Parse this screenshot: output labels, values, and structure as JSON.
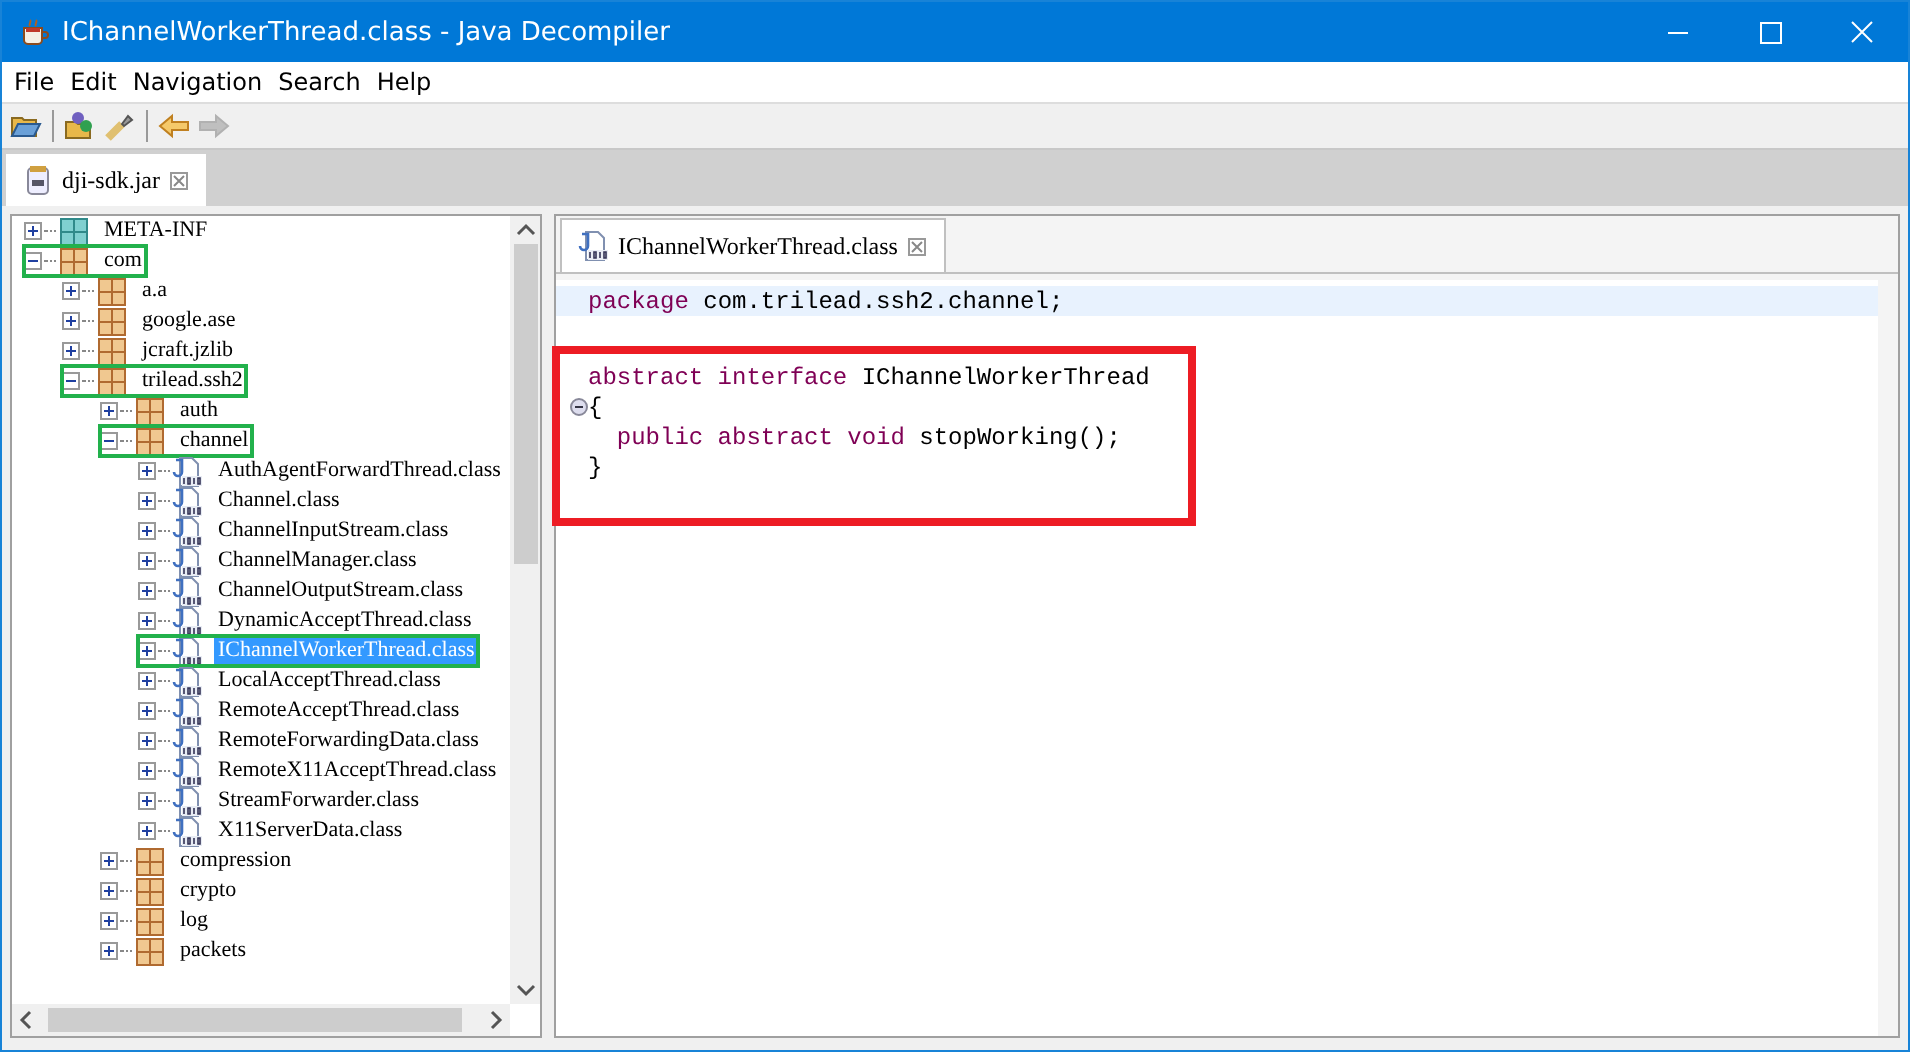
{
  "window": {
    "title": "IChannelWorkerThread.class - Java Decompiler"
  },
  "menu": [
    "File",
    "Edit",
    "Navigation",
    "Search",
    "Help"
  ],
  "toolbar": [
    {
      "kind": "open",
      "disabled": false
    },
    {
      "kind": "sep"
    },
    {
      "kind": "open-type",
      "disabled": false
    },
    {
      "kind": "search",
      "disabled": false
    },
    {
      "kind": "sep"
    },
    {
      "kind": "back",
      "disabled": false
    },
    {
      "kind": "forward",
      "disabled": true
    }
  ],
  "file_tabs": [
    {
      "label": "dji-sdk.jar",
      "selected": true
    }
  ],
  "tree": [
    {
      "label": "META-INF",
      "kind": "folder",
      "expanded": false,
      "selected": false,
      "outlined": false
    },
    {
      "label": "com",
      "kind": "package",
      "expanded": true,
      "selected": false,
      "outlined": true,
      "children": [
        {
          "label": "a.a",
          "kind": "package",
          "expanded": false,
          "selected": false,
          "outlined": false
        },
        {
          "label": "google.ase",
          "kind": "package",
          "expanded": false,
          "selected": false,
          "outlined": false
        },
        {
          "label": "jcraft.jzlib",
          "kind": "package",
          "expanded": false,
          "selected": false,
          "outlined": false
        },
        {
          "label": "trilead.ssh2",
          "kind": "package",
          "expanded": true,
          "selected": false,
          "outlined": true,
          "children": [
            {
              "label": "auth",
              "kind": "package",
              "expanded": false,
              "selected": false,
              "outlined": false
            },
            {
              "label": "channel",
              "kind": "package",
              "expanded": true,
              "selected": false,
              "outlined": true,
              "children": [
                {
                  "label": "AuthAgentForwardThread.class",
                  "kind": "class",
                  "expanded": false,
                  "selected": false,
                  "outlined": false
                },
                {
                  "label": "Channel.class",
                  "kind": "class",
                  "expanded": false,
                  "selected": false,
                  "outlined": false
                },
                {
                  "label": "ChannelInputStream.class",
                  "kind": "class",
                  "expanded": false,
                  "selected": false,
                  "outlined": false
                },
                {
                  "label": "ChannelManager.class",
                  "kind": "class",
                  "expanded": false,
                  "selected": false,
                  "outlined": false
                },
                {
                  "label": "ChannelOutputStream.class",
                  "kind": "class",
                  "expanded": false,
                  "selected": false,
                  "outlined": false
                },
                {
                  "label": "DynamicAcceptThread.class",
                  "kind": "class",
                  "expanded": false,
                  "selected": false,
                  "outlined": false
                },
                {
                  "label": "IChannelWorkerThread.class",
                  "kind": "class",
                  "expanded": false,
                  "selected": true,
                  "outlined": true
                },
                {
                  "label": "LocalAcceptThread.class",
                  "kind": "class",
                  "expanded": false,
                  "selected": false,
                  "outlined": false
                },
                {
                  "label": "RemoteAcceptThread.class",
                  "kind": "class",
                  "expanded": false,
                  "selected": false,
                  "outlined": false
                },
                {
                  "label": "RemoteForwardingData.class",
                  "kind": "class",
                  "expanded": false,
                  "selected": false,
                  "outlined": false
                },
                {
                  "label": "RemoteX11AcceptThread.class",
                  "kind": "class",
                  "expanded": false,
                  "selected": false,
                  "outlined": false
                },
                {
                  "label": "StreamForwarder.class",
                  "kind": "class",
                  "expanded": false,
                  "selected": false,
                  "outlined": false
                },
                {
                  "label": "X11ServerData.class",
                  "kind": "class",
                  "expanded": false,
                  "selected": false,
                  "outlined": false
                }
              ]
            },
            {
              "label": "compression",
              "kind": "package",
              "expanded": false,
              "selected": false,
              "outlined": false
            },
            {
              "label": "crypto",
              "kind": "package",
              "expanded": false,
              "selected": false,
              "outlined": false
            },
            {
              "label": "log",
              "kind": "package",
              "expanded": false,
              "selected": false,
              "outlined": false
            },
            {
              "label": "packets",
              "kind": "package",
              "expanded": false,
              "selected": false,
              "outlined": false
            }
          ]
        }
      ]
    }
  ],
  "editor_tabs": [
    {
      "label": "IChannelWorkerThread.class",
      "selected": true
    }
  ],
  "code": {
    "blocks": [
      {
        "outlined": false,
        "lines": [
          {
            "current": true,
            "foldable": false,
            "tokens": [
              {
                "kind": "keyword",
                "text": "package"
              },
              {
                "kind": "plain",
                "text": " com.trilead.ssh2.channel;"
              }
            ]
          }
        ]
      },
      {
        "outlined": true,
        "lines": [
          {
            "current": false,
            "foldable": false,
            "tokens": [
              {
                "kind": "keyword",
                "text": "abstract"
              },
              {
                "kind": "keyword",
                "text": " interface"
              },
              {
                "kind": "plain",
                "text": " IChannelWorkerThread"
              }
            ]
          },
          {
            "current": false,
            "foldable": true,
            "tokens": [
              {
                "kind": "plain",
                "text": "{"
              }
            ]
          },
          {
            "current": false,
            "foldable": false,
            "tokens": [
              {
                "kind": "keyword",
                "text": "  public"
              },
              {
                "kind": "keyword",
                "text": " abstract"
              },
              {
                "kind": "keyword",
                "text": " void"
              },
              {
                "kind": "plain",
                "text": " stopWorking();"
              }
            ]
          },
          {
            "current": false,
            "foldable": false,
            "tokens": [
              {
                "kind": "plain",
                "text": "}"
              }
            ]
          }
        ]
      }
    ]
  }
}
